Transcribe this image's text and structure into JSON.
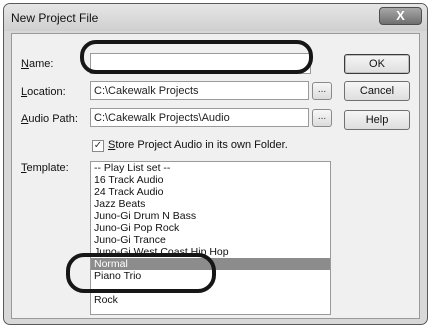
{
  "window": {
    "title": "New Project File",
    "close_glyph": "X"
  },
  "fields": {
    "name": {
      "label": "Name:",
      "accel": "N",
      "rest": "ame:",
      "value": ""
    },
    "location": {
      "label": "Location:",
      "accel": "L",
      "rest": "ocation:",
      "value": "C:\\Cakewalk Projects"
    },
    "audio_path": {
      "label": "Audio Path:",
      "accel": "A",
      "rest": "udio Path:",
      "value": "C:\\Cakewalk Projects\\Audio"
    }
  },
  "browse_label": "...",
  "checkbox": {
    "checked": true,
    "mark": "✓",
    "accel": "S",
    "rest": "tore Project Audio in its own Folder.",
    "label": "Store Project Audio in its own Folder."
  },
  "template": {
    "label": "Template:",
    "accel": "T",
    "rest": "emplate:",
    "items": [
      "-- Play List set --",
      "16 Track Audio",
      "24 Track Audio",
      "Jazz Beats",
      "Juno-Gi Drum N Bass",
      "Juno-Gi Pop Rock",
      "Juno-Gi Trance",
      "Juno-Gi West Coast Hip Hop",
      "Normal",
      "Piano Trio",
      "Rock"
    ],
    "selected": "Normal",
    "visible_fragments": {
      "west_coast": "ip Hop",
      "piano_trio": "P  mo Trio"
    }
  },
  "buttons": {
    "ok": "OK",
    "cancel": "Cancel",
    "help": "Help"
  }
}
